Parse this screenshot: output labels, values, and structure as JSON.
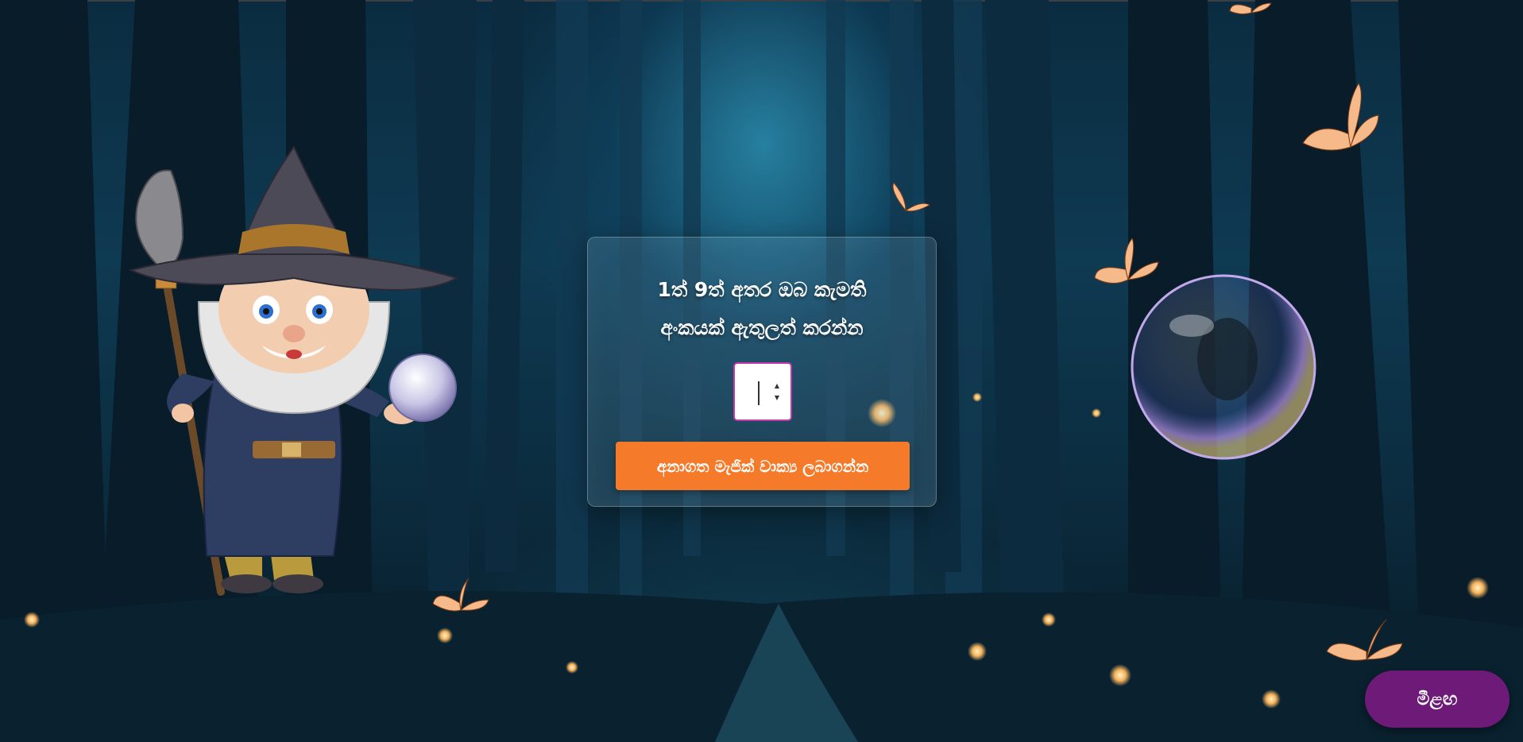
{
  "page": {
    "prompt_line1": "1ත් 9ත් අතර ඔබ කැමති",
    "prompt_line2": "අංකයක් ඇතුලත් කරන්න"
  },
  "number_input": {
    "value": "",
    "min": "1",
    "max": "9"
  },
  "buttons": {
    "submit_label": "අනාගත මැජික් වාක්‍ය ලබාගන්න",
    "home_label": "මීළඟ"
  },
  "colors": {
    "accent_button": "#f57a2a",
    "home_button": "#6d1a78",
    "input_border": "#c03aa8"
  },
  "icons": {
    "wizard": "wizard-character-icon",
    "bubble": "soap-bubble-icon",
    "butterfly": "butterfly-icon"
  }
}
